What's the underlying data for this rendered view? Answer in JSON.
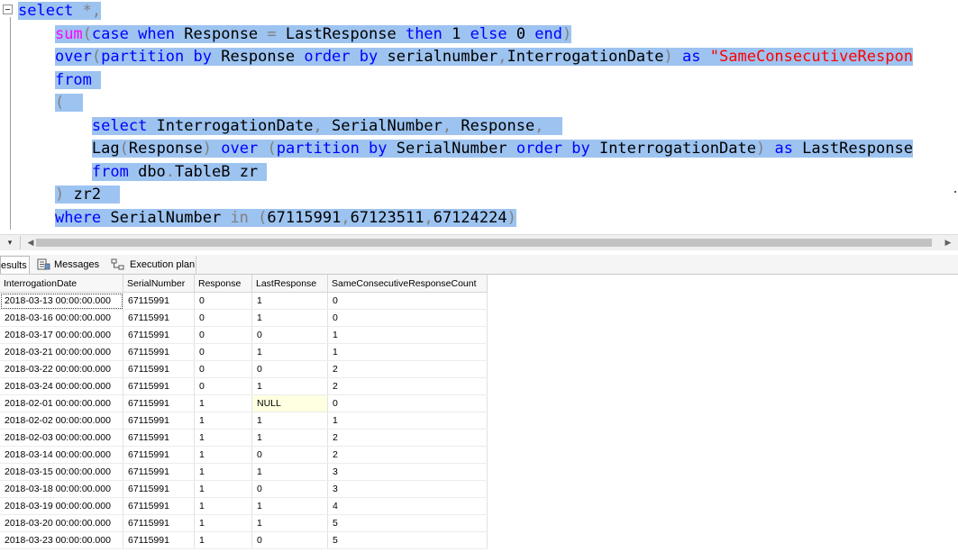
{
  "editor": {
    "lines": [
      [
        [
          "kw",
          "select"
        ],
        [
          "txt",
          " "
        ],
        [
          "op",
          "*,"
        ]
      ],
      [
        [
          "txt",
          "    "
        ],
        [
          "fn",
          "sum"
        ],
        [
          "op",
          "("
        ],
        [
          "kw",
          "case when"
        ],
        [
          "txt",
          " Response "
        ],
        [
          "op",
          "="
        ],
        [
          "txt",
          " LastResponse "
        ],
        [
          "kw",
          "then"
        ],
        [
          "txt",
          " 1 "
        ],
        [
          "kw",
          "else"
        ],
        [
          "txt",
          " 0 "
        ],
        [
          "kw",
          "end"
        ],
        [
          "op",
          ")"
        ]
      ],
      [
        [
          "txt",
          "    "
        ],
        [
          "kw",
          "over"
        ],
        [
          "op",
          "("
        ],
        [
          "kw",
          "partition by"
        ],
        [
          "txt",
          " Response "
        ],
        [
          "kw",
          "order by"
        ],
        [
          "txt",
          " serialnumber"
        ],
        [
          "op",
          ","
        ],
        [
          "txt",
          "InterrogationDate"
        ],
        [
          "op",
          ")"
        ],
        [
          "txt",
          " "
        ],
        [
          "kw",
          "as"
        ],
        [
          "txt",
          " "
        ],
        [
          "st",
          "\"SameConsecutiveRespon"
        ]
      ],
      [
        [
          "txt",
          "    "
        ],
        [
          "kw",
          "from"
        ],
        [
          "txt",
          " "
        ]
      ],
      [
        [
          "txt",
          "    "
        ],
        [
          "op",
          "("
        ],
        [
          "txt",
          "  "
        ]
      ],
      [
        [
          "txt",
          "        "
        ],
        [
          "kw",
          "select"
        ],
        [
          "txt",
          " InterrogationDate"
        ],
        [
          "op",
          ","
        ],
        [
          "txt",
          " SerialNumber"
        ],
        [
          "op",
          ","
        ],
        [
          "txt",
          " Response"
        ],
        [
          "op",
          ","
        ],
        [
          "txt",
          "  "
        ]
      ],
      [
        [
          "txt",
          "        "
        ],
        [
          "txt",
          "Lag"
        ],
        [
          "op",
          "("
        ],
        [
          "txt",
          "Response"
        ],
        [
          "op",
          ")"
        ],
        [
          "txt",
          " "
        ],
        [
          "kw",
          "over"
        ],
        [
          "txt",
          " "
        ],
        [
          "op",
          "("
        ],
        [
          "kw",
          "partition by"
        ],
        [
          "txt",
          " SerialNumber "
        ],
        [
          "kw",
          "order by"
        ],
        [
          "txt",
          " InterrogationDate"
        ],
        [
          "op",
          ")"
        ],
        [
          "txt",
          " "
        ],
        [
          "kw",
          "as"
        ],
        [
          "txt",
          " LastResponse"
        ]
      ],
      [
        [
          "txt",
          "        "
        ],
        [
          "kw",
          "from"
        ],
        [
          "txt",
          " dbo"
        ],
        [
          "op",
          "."
        ],
        [
          "txt",
          "TableB zr "
        ]
      ],
      [
        [
          "txt",
          "    "
        ],
        [
          "op",
          ")"
        ],
        [
          "txt",
          " zr2  "
        ]
      ],
      [
        [
          "txt",
          "    "
        ],
        [
          "kw",
          "where"
        ],
        [
          "txt",
          " SerialNumber "
        ],
        [
          "op",
          "in"
        ],
        [
          "txt",
          " "
        ],
        [
          "op",
          "("
        ],
        [
          "txt",
          "67115991"
        ],
        [
          "op",
          ","
        ],
        [
          "txt",
          "67123511"
        ],
        [
          "op",
          ","
        ],
        [
          "txt",
          "67124224"
        ],
        [
          "op",
          ")"
        ]
      ]
    ]
  },
  "tabs": {
    "results": "esults",
    "messages": "Messages",
    "execution_plan": "Execution plan"
  },
  "grid": {
    "columns": [
      "InterrogationDate",
      "SerialNumber",
      "Response",
      "LastResponse",
      "SameConsecutiveResponseCount"
    ],
    "rows": [
      [
        "2018-03-13 00:00:00.000",
        "67115991",
        "0",
        "1",
        "0"
      ],
      [
        "2018-03-16 00:00:00.000",
        "67115991",
        "0",
        "1",
        "0"
      ],
      [
        "2018-03-17 00:00:00.000",
        "67115991",
        "0",
        "0",
        "1"
      ],
      [
        "2018-03-21 00:00:00.000",
        "67115991",
        "0",
        "1",
        "1"
      ],
      [
        "2018-03-22 00:00:00.000",
        "67115991",
        "0",
        "0",
        "2"
      ],
      [
        "2018-03-24 00:00:00.000",
        "67115991",
        "0",
        "1",
        "2"
      ],
      [
        "2018-02-01 00:00:00.000",
        "67115991",
        "1",
        "NULL",
        "0"
      ],
      [
        "2018-02-02 00:00:00.000",
        "67115991",
        "1",
        "1",
        "1"
      ],
      [
        "2018-02-03 00:00:00.000",
        "67115991",
        "1",
        "1",
        "2"
      ],
      [
        "2018-03-14 00:00:00.000",
        "67115991",
        "1",
        "0",
        "2"
      ],
      [
        "2018-03-15 00:00:00.000",
        "67115991",
        "1",
        "1",
        "3"
      ],
      [
        "2018-03-18 00:00:00.000",
        "67115991",
        "1",
        "0",
        "3"
      ],
      [
        "2018-03-19 00:00:00.000",
        "67115991",
        "1",
        "1",
        "4"
      ],
      [
        "2018-03-20 00:00:00.000",
        "67115991",
        "1",
        "1",
        "5"
      ],
      [
        "2018-03-23 00:00:00.000",
        "67115991",
        "1",
        "0",
        "5"
      ]
    ]
  },
  "colors": {
    "selection": "#9dc3f0",
    "keyword": "#0000ff",
    "function": "#ff00ff",
    "operator": "#808080",
    "string": "#ff0000",
    "null_cell": "#ffffe1"
  },
  "icons": {
    "collapse": "collapse-minus-icon",
    "messages": "messages-icon",
    "execution_plan": "execution-plan-icon"
  }
}
